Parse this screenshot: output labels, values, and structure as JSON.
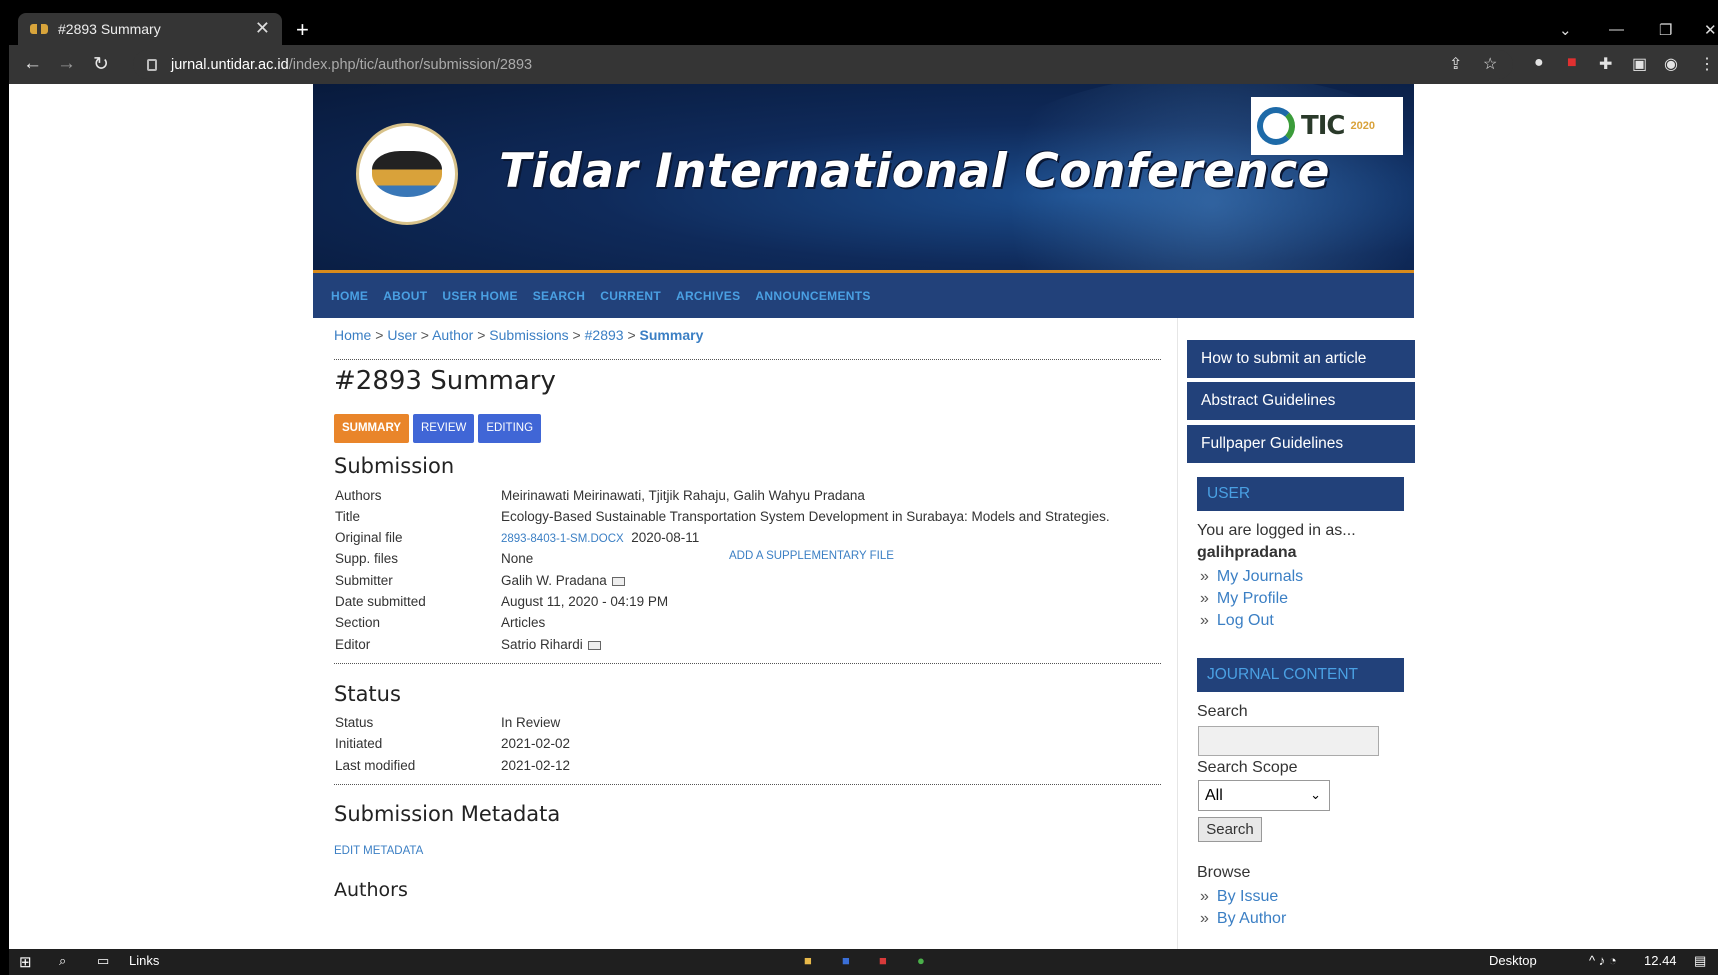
{
  "browser": {
    "tab_title": "#2893 Summary",
    "url_host": "jurnal.untidar.ac.id",
    "url_path": "/index.php/tic/author/submission/2893"
  },
  "site": {
    "banner_title": "Tidar International Conference",
    "logo_text": "UNIVERSITAS TIDAR",
    "badge_text": "TIC",
    "badge_year": "2020",
    "nav": [
      "HOME",
      "ABOUT",
      "USER HOME",
      "SEARCH",
      "CURRENT",
      "ARCHIVES",
      "ANNOUNCEMENTS"
    ]
  },
  "breadcrumb": {
    "items": [
      "Home",
      "User",
      "Author",
      "Submissions",
      "#2893"
    ],
    "current": "Summary"
  },
  "page_title": "#2893 Summary",
  "tabs": [
    "SUMMARY",
    "REVIEW",
    "EDITING"
  ],
  "submission": {
    "heading": "Submission",
    "authors_label": "Authors",
    "authors": "Meirinawati Meirinawati, Tjitjik Rahaju, Galih Wahyu Pradana",
    "title_label": "Title",
    "title": "Ecology-Based Sustainable Transportation System Development in Surabaya: Models and Strategies.",
    "original_file_label": "Original file",
    "original_file": "2893-8403-1-SM.DOCX",
    "original_file_date": "2020-08-11",
    "supp_label": "Supp. files",
    "supp": "None",
    "add_supp": "ADD A SUPPLEMENTARY FILE",
    "submitter_label": "Submitter",
    "submitter": "Galih W. Pradana",
    "date_label": "Date submitted",
    "date": "August 11, 2020 - 04:19 PM",
    "section_label": "Section",
    "section": "Articles",
    "editor_label": "Editor",
    "editor": "Satrio Rihardi"
  },
  "status": {
    "heading": "Status",
    "status_label": "Status",
    "status": "In Review",
    "initiated_label": "Initiated",
    "initiated": "2021-02-02",
    "modified_label": "Last modified",
    "modified": "2021-02-12"
  },
  "metadata": {
    "heading": "Submission Metadata",
    "edit": "EDIT METADATA",
    "authors_heading": "Authors"
  },
  "sidebar": {
    "buttons": [
      "How to submit an article",
      "Abstract Guidelines",
      "Fullpaper Guidelines"
    ],
    "user_heading": "USER",
    "logged_in": "You are logged in as...",
    "username": "galihpradana",
    "user_links": [
      "My Journals",
      "My Profile",
      "Log Out"
    ],
    "journal_heading": "JOURNAL CONTENT",
    "search_label": "Search",
    "scope_label": "Search Scope",
    "scope_value": "All",
    "search_button": "Search",
    "browse_label": "Browse",
    "browse_links": [
      "By Issue",
      "By Author"
    ]
  },
  "taskbar": {
    "links": "Links",
    "desktop": "Desktop",
    "time": "12.44"
  }
}
